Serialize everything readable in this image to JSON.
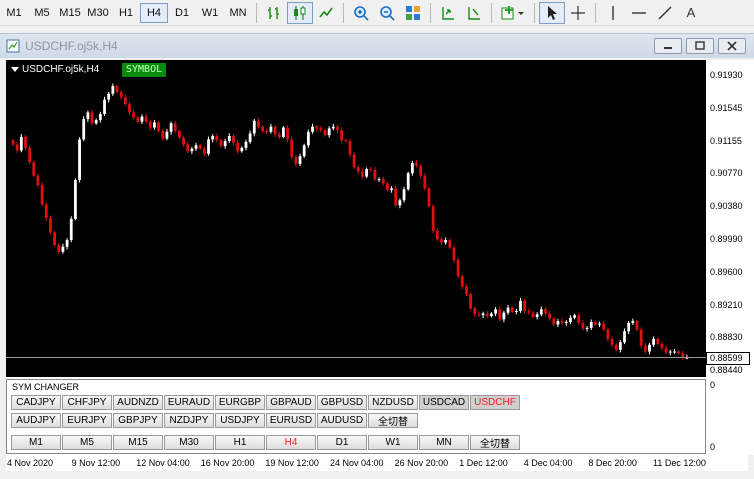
{
  "toolbar": {
    "timeframes": [
      "M1",
      "M5",
      "M15",
      "M30",
      "H1",
      "H4",
      "D1",
      "W1",
      "MN"
    ],
    "active_timeframe": "H4",
    "text_tool_label": "A"
  },
  "window": {
    "title": "USDCHF.oj5k,H4"
  },
  "chart": {
    "title": "USDCHF.oj5k,H4",
    "symbol_tag": "SYMBOL",
    "current_price": "0.88599",
    "price_labels": [
      "0.91930",
      "0.91545",
      "0.91155",
      "0.90770",
      "0.90380",
      "0.89990",
      "0.89600",
      "0.89210",
      "0.88830",
      "0.88440"
    ],
    "time_labels": [
      "4 Nov 2020",
      "9 Nov 12:00",
      "12 Nov 04:00",
      "16 Nov 20:00",
      "19 Nov 12:00",
      "24 Nov 04:00",
      "26 Nov 20:00",
      "1 Dec 12:00",
      "4 Dec 04:00",
      "8 Dec 20:00",
      "11 Dec 12:00"
    ],
    "sub_window_max": "0",
    "sub_window_min": "0",
    "colors": {
      "bull": "#ffffff",
      "bear": "#e01010",
      "bg": "#000000"
    }
  },
  "sym_changer": {
    "header": "SYM CHANGER",
    "row1": [
      "CADJPY",
      "CHFJPY",
      "AUDNZD",
      "EURAUD",
      "EURGBP",
      "GBPAUD",
      "GBPUSD",
      "NZDUSD",
      "USDCAD",
      "USDCHF"
    ],
    "row2": [
      "AUDJPY",
      "EURJPY",
      "GBPJPY",
      "NZDJPY",
      "USDJPY",
      "EURUSD",
      "AUDUSD",
      "全切替"
    ],
    "row3": [
      "M1",
      "M5",
      "M15",
      "M30",
      "H1",
      "H4",
      "D1",
      "W1",
      "MN",
      "全切替"
    ],
    "active_symbol": "USDCHF",
    "active_tf": "H4"
  },
  "chart_data": {
    "type": "candlestick",
    "ylim": [
      0.8844,
      0.9193
    ],
    "closes": [
      0.9112,
      0.9105,
      0.9121,
      0.9108,
      0.9091,
      0.9075,
      0.9064,
      0.9041,
      0.9025,
      0.9008,
      0.8993,
      0.8985,
      0.8991,
      0.8999,
      0.9024,
      0.907,
      0.9118,
      0.9142,
      0.915,
      0.9137,
      0.9141,
      0.9148,
      0.9165,
      0.9172,
      0.9181,
      0.9174,
      0.9168,
      0.916,
      0.915,
      0.9144,
      0.9139,
      0.9145,
      0.9139,
      0.9132,
      0.9138,
      0.9128,
      0.9119,
      0.9127,
      0.9137,
      0.9128,
      0.912,
      0.9112,
      0.9104,
      0.9107,
      0.9111,
      0.9107,
      0.9101,
      0.9118,
      0.9122,
      0.9117,
      0.911,
      0.9116,
      0.9122,
      0.9114,
      0.9104,
      0.9108,
      0.9115,
      0.9125,
      0.914,
      0.9133,
      0.9128,
      0.9127,
      0.9133,
      0.9124,
      0.9121,
      0.9132,
      0.9118,
      0.9097,
      0.9089,
      0.9098,
      0.9111,
      0.9127,
      0.9133,
      0.9131,
      0.9129,
      0.9123,
      0.9131,
      0.9133,
      0.9129,
      0.9117,
      0.9116,
      0.91,
      0.9085,
      0.908,
      0.9074,
      0.9083,
      0.9082,
      0.9071,
      0.9071,
      0.9066,
      0.9058,
      0.906,
      0.904,
      0.9046,
      0.9059,
      0.9078,
      0.909,
      0.9087,
      0.9075,
      0.906,
      0.9039,
      0.901,
      0.9,
      0.8996,
      0.8999,
      0.899,
      0.8975,
      0.8956,
      0.8944,
      0.8935,
      0.8918,
      0.8911,
      0.891,
      0.8912,
      0.8909,
      0.8912,
      0.8917,
      0.8905,
      0.8913,
      0.8919,
      0.8914,
      0.8915,
      0.8927,
      0.8915,
      0.8913,
      0.8908,
      0.8911,
      0.8917,
      0.8912,
      0.8906,
      0.8899,
      0.8903,
      0.8901,
      0.8902,
      0.8907,
      0.891,
      0.8901,
      0.8894,
      0.8895,
      0.8902,
      0.8899,
      0.89,
      0.8893,
      0.8882,
      0.8875,
      0.8869,
      0.8878,
      0.8891,
      0.8901,
      0.8903,
      0.8893,
      0.8874,
      0.8867,
      0.8875,
      0.8882,
      0.8876,
      0.8871,
      0.8866,
      0.8867,
      0.8867,
      0.8865,
      0.886,
      0.886
    ]
  }
}
